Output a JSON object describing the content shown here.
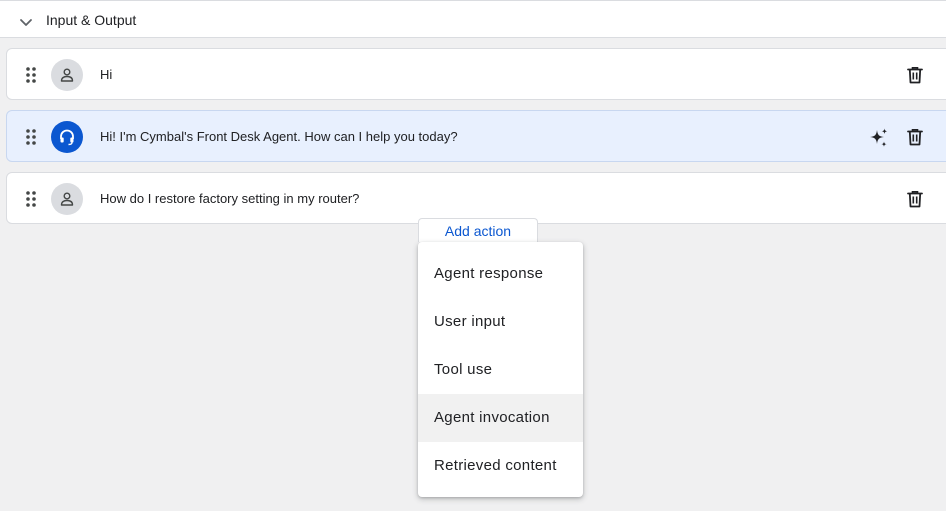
{
  "section": {
    "title": "Input & Output"
  },
  "rows": [
    {
      "role": "user",
      "text": "Hi"
    },
    {
      "role": "agent",
      "text": "Hi! I'm Cymbal's Front Desk Agent. How can I help you today?"
    },
    {
      "role": "user",
      "text": "How do I restore factory setting in my router?"
    }
  ],
  "add_action": {
    "label": "Add action"
  },
  "menu": {
    "items": [
      {
        "label": "Agent response"
      },
      {
        "label": "User input"
      },
      {
        "label": "Tool use"
      },
      {
        "label": "Agent invocation",
        "highlighted": true
      },
      {
        "label": "Retrieved content"
      }
    ]
  },
  "colors": {
    "accent": "#0b57d0",
    "agent_row_bg": "#e8f0fe",
    "page_bg": "#f0f0f1"
  },
  "icons": {
    "collapse": "chevron-down-icon",
    "drag": "drag-handle-icon",
    "user_avatar": "person-icon",
    "agent_avatar": "headset-icon",
    "delete": "trash-icon",
    "ai": "sparkle-icon"
  }
}
